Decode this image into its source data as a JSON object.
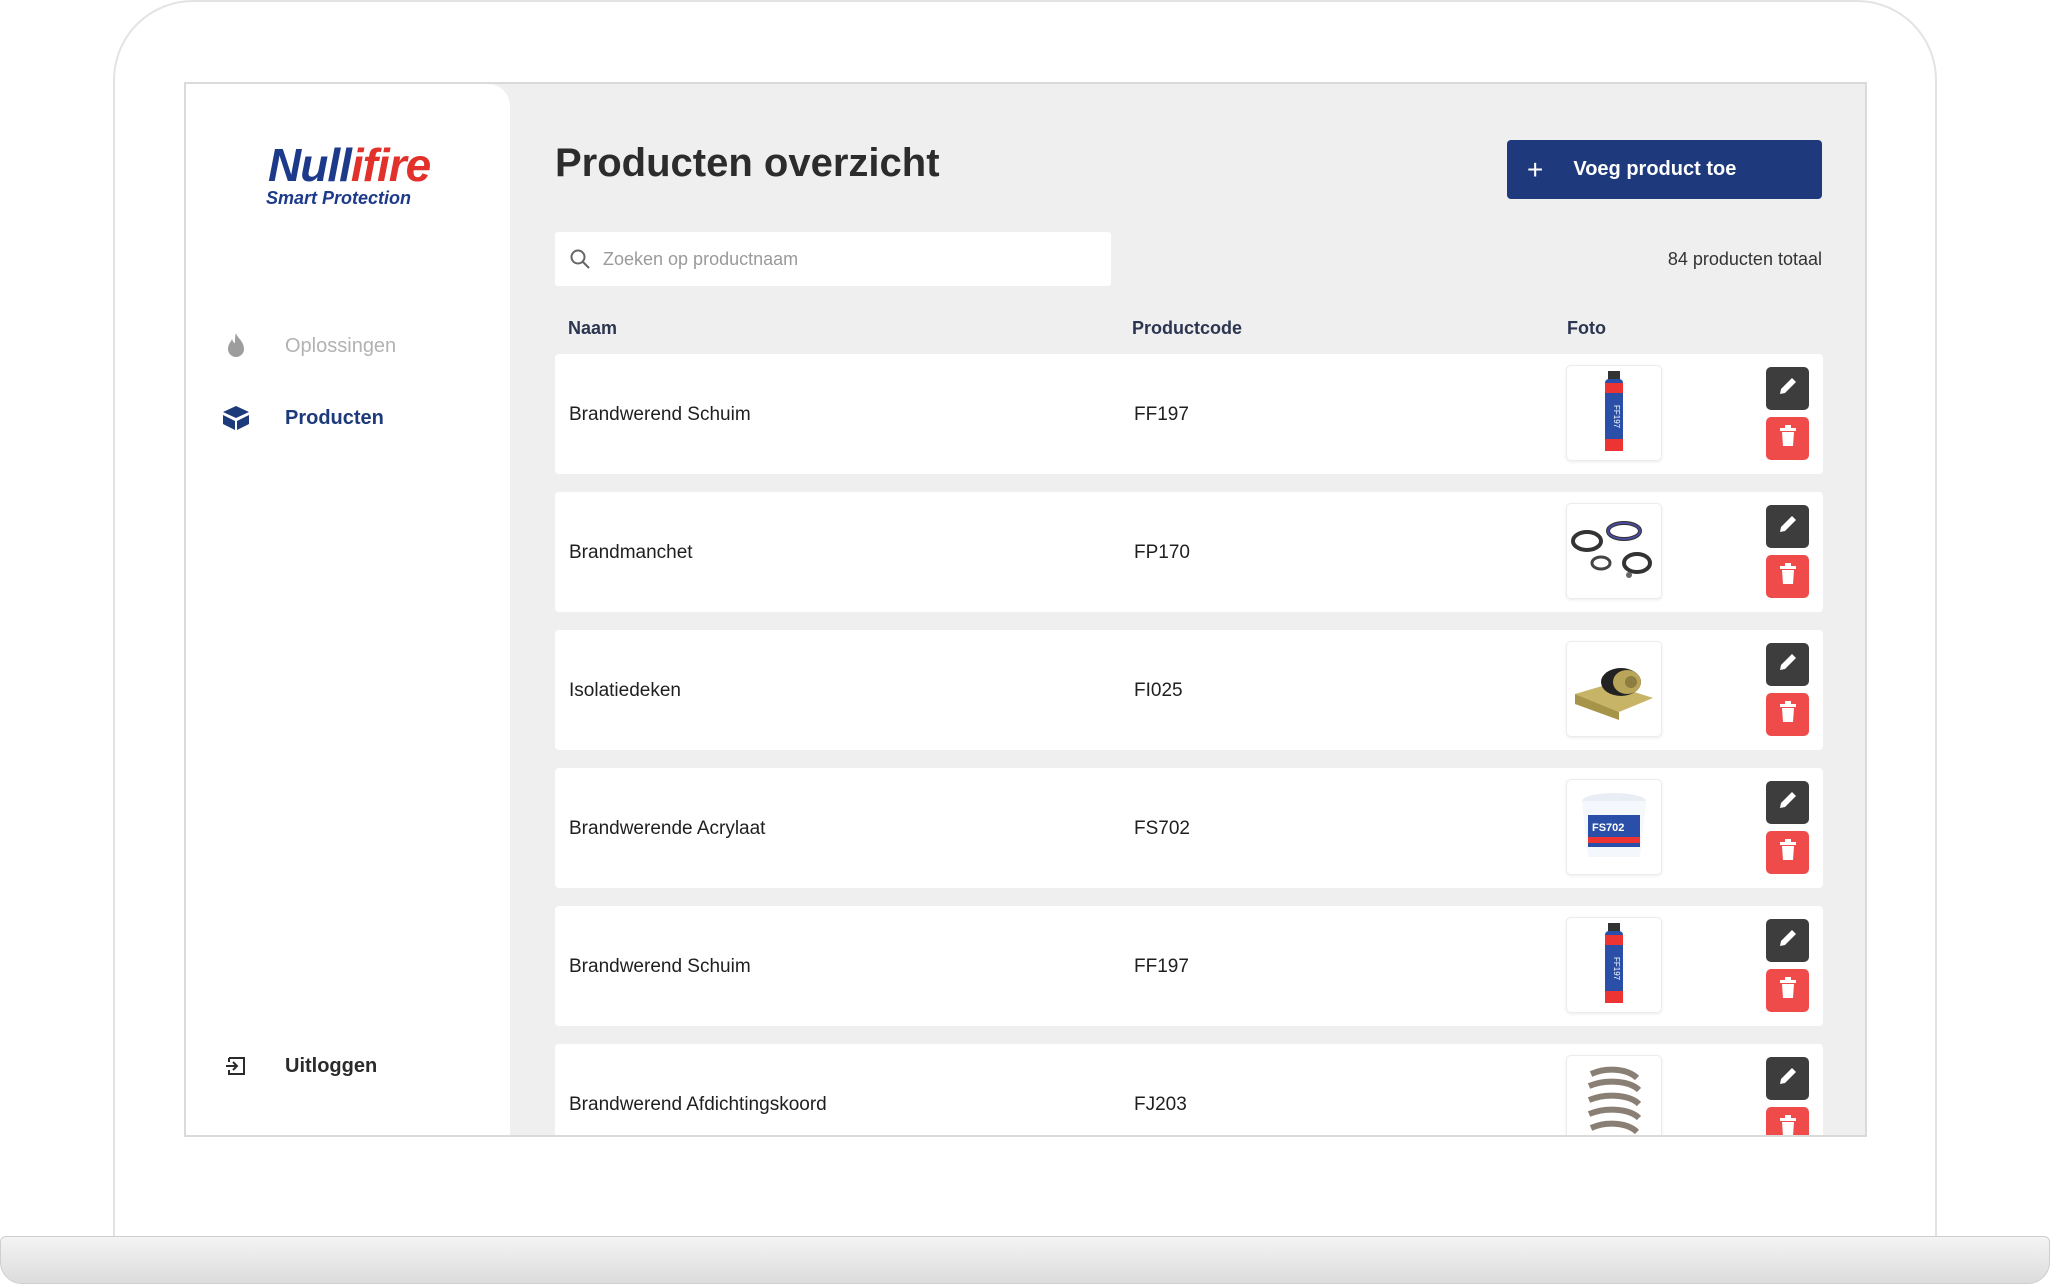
{
  "brand": {
    "name_part1": "Null",
    "name_part2": "ifire",
    "tagline": "Smart Protection"
  },
  "sidebar": {
    "items": [
      {
        "label": "Oplossingen",
        "icon": "flame-icon",
        "active": false
      },
      {
        "label": "Producten",
        "icon": "box-icon",
        "active": true
      }
    ],
    "logout_label": "Uitloggen"
  },
  "header": {
    "title": "Producten overzicht",
    "add_button_label": "Voeg product toe"
  },
  "search": {
    "placeholder": "Zoeken op productnaam",
    "value": ""
  },
  "total_text": "84 producten totaal",
  "table": {
    "columns": [
      "Naam",
      "Productcode",
      "Foto"
    ],
    "rows": [
      {
        "name": "Brandwerend Schuim",
        "code": "FF197",
        "photo": "spray-can"
      },
      {
        "name": "Brandmanchet",
        "code": "FP170",
        "photo": "collars"
      },
      {
        "name": "Isolatiedeken",
        "code": "FI025",
        "photo": "insulation-roll"
      },
      {
        "name": "Brandwerende Acrylaat",
        "code": "FS702",
        "photo": "bucket"
      },
      {
        "name": "Brandwerend Schuim",
        "code": "FF197",
        "photo": "spray-can"
      },
      {
        "name": "Brandwerend Afdichtingskoord",
        "code": "FJ203",
        "photo": "rope-coil"
      }
    ]
  },
  "colors": {
    "primary": "#1f3a7c",
    "danger": "#f04b4b",
    "edit": "#3d3d3d",
    "brand_blue": "#1d3a8a",
    "brand_red": "#e2302b"
  }
}
